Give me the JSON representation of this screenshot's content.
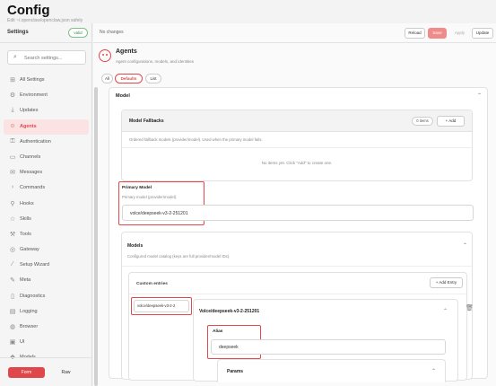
{
  "header": {
    "title": "Config",
    "subtitle": "Edit ~/.openclaw/openclaw.json safely"
  },
  "sidebar": {
    "label": "Settings",
    "valid_badge": "valid",
    "search_placeholder": "Search settings...",
    "items": [
      {
        "label": "All Settings",
        "icon": "grid-icon"
      },
      {
        "label": "Environment",
        "icon": "gear-icon"
      },
      {
        "label": "Updates",
        "icon": "download-icon"
      },
      {
        "label": "Agents",
        "icon": "agent-icon"
      },
      {
        "label": "Authentication",
        "icon": "key-icon"
      },
      {
        "label": "Channels",
        "icon": "chat-icon"
      },
      {
        "label": "Messages",
        "icon": "message-icon"
      },
      {
        "label": "Commands",
        "icon": "terminal-icon"
      },
      {
        "label": "Hooks",
        "icon": "link-icon"
      },
      {
        "label": "Skills",
        "icon": "star-icon"
      },
      {
        "label": "Tools",
        "icon": "wrench-icon"
      },
      {
        "label": "Gateway",
        "icon": "globe-icon"
      },
      {
        "label": "Setup Wizard",
        "icon": "wand-icon"
      },
      {
        "label": "Meta",
        "icon": "pencil-icon"
      },
      {
        "label": "Diagnostics",
        "icon": "file-icon"
      },
      {
        "label": "Logging",
        "icon": "log-icon"
      },
      {
        "label": "Browser",
        "icon": "browser-icon"
      },
      {
        "label": "UI",
        "icon": "monitor-icon"
      },
      {
        "label": "Models",
        "icon": "cube-icon"
      }
    ],
    "active_item": "Agents",
    "mode_form": "Form",
    "mode_raw": "Raw"
  },
  "topbar": {
    "status": "No changes",
    "reload": "Reload",
    "save": "Save",
    "apply": "Apply",
    "update": "Update"
  },
  "section": {
    "title": "Agents",
    "description": "Agent configurations, models, and identities"
  },
  "tabs": [
    {
      "label": "All"
    },
    {
      "label": "Defaults"
    },
    {
      "label": "List"
    }
  ],
  "model": {
    "heading": "Model",
    "fallbacks": {
      "title": "Model Fallbacks",
      "count": "0 items",
      "add": "+ Add",
      "description": "Ordered fallback models (provider/model). Used when the primary model fails.",
      "empty": "No items yet. Click \"Add\" to create one."
    },
    "primary": {
      "label": "Primary Model",
      "description": "Primary model (provider/model).",
      "value": "volce/deepseek-v3-2-251201"
    }
  },
  "models": {
    "title": "Models",
    "description": "Configured model catalog (keys are full provider/model IDs).",
    "custom_entries": "Custom entries",
    "add_entry": "+ Add Entry",
    "entry": {
      "key": "volce/deepseek-v3-2-2",
      "title": "Volce/deepseek-v3-2-251201",
      "alias_label": "Alias",
      "alias_value": "deepseek",
      "params": "Params"
    }
  }
}
